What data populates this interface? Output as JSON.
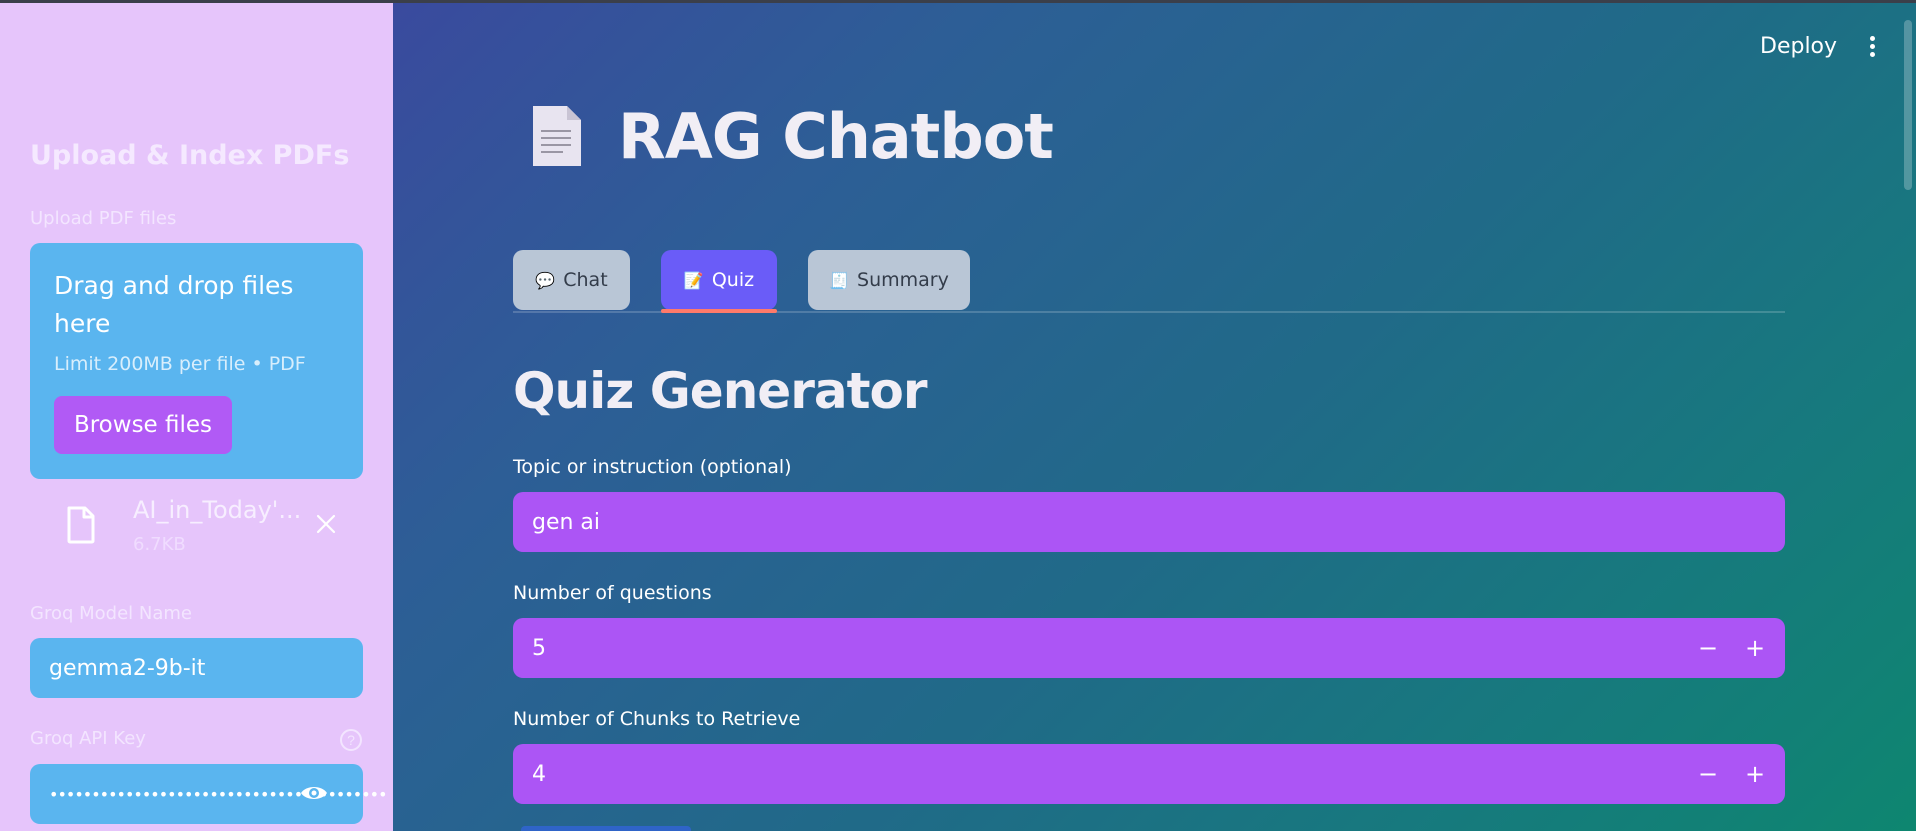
{
  "sidebar": {
    "title": "Upload & Index PDFs",
    "upload_label": "Upload PDF files",
    "dropzone": {
      "title": "Drag and drop files here",
      "limit": "Limit 200MB per file • PDF",
      "browse_label": "Browse files"
    },
    "file": {
      "name": "AI_in_Today'...",
      "size": "6.7KB"
    },
    "model_label": "Groq Model Name",
    "model_value": "gemma2-9b-it",
    "api_key_label": "Groq API Key",
    "api_key_value": "••••••••••••••••••••••••••••••••••••••••"
  },
  "header": {
    "deploy_label": "Deploy",
    "app_title": "RAG Chatbot"
  },
  "tabs": [
    {
      "label": "Chat",
      "icon": "speech-balloon-icon",
      "active": false
    },
    {
      "label": "Quiz",
      "icon": "memo-icon",
      "active": true
    },
    {
      "label": "Summary",
      "icon": "receipt-icon",
      "active": false
    }
  ],
  "quiz": {
    "title": "Quiz Generator",
    "topic_label": "Topic or instruction (optional)",
    "topic_value": "gen ai",
    "num_questions_label": "Number of questions",
    "num_questions_value": "5",
    "chunks_label": "Number of Chunks to Retrieve",
    "chunks_value": "4",
    "minus": "−",
    "plus": "+"
  },
  "colors": {
    "sidebar_bg": "#e6c5fb",
    "sidebar_field": "#5ab5ef",
    "main_field": "#ac55f5",
    "active_tab": "#6a5cf8",
    "browse_button": "#b15af5"
  }
}
